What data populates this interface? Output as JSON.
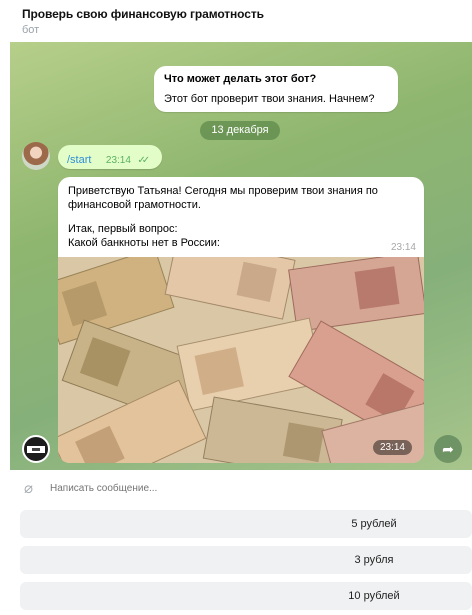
{
  "header": {
    "title": "Проверь свою финансовую грамотность",
    "subtitle": "бот"
  },
  "intro_message": {
    "title": "Что может делать этот бот?",
    "text": "Этот бот проверит твои знания. Начнем?"
  },
  "date_separator": "13 декабря",
  "user_message": {
    "text": "/start",
    "time": "23:14",
    "status_icon": "double-check-icon"
  },
  "bot_message": {
    "greeting": "Приветствую Татьяна!  Сегодня мы проверим твои знания по финансовой грамотности.",
    "question_intro": "Итак, первый вопрос:",
    "question": "Какой банкноты нет в России:",
    "time": "23:14",
    "photo_time": "23:14",
    "photo_description": "banknotes-photo"
  },
  "composer": {
    "placeholder": "Написать сообщение..."
  },
  "keyboard": {
    "buttons": [
      "5 рублей",
      "3 рубля",
      "10 рублей"
    ]
  },
  "colors": {
    "chat_background": "#8fb66f",
    "outgoing_bubble": "#e3fdc8",
    "link_blue": "#2f8fd6",
    "tick_green": "#5bb163",
    "keyboard_button": "#eff1f3"
  }
}
